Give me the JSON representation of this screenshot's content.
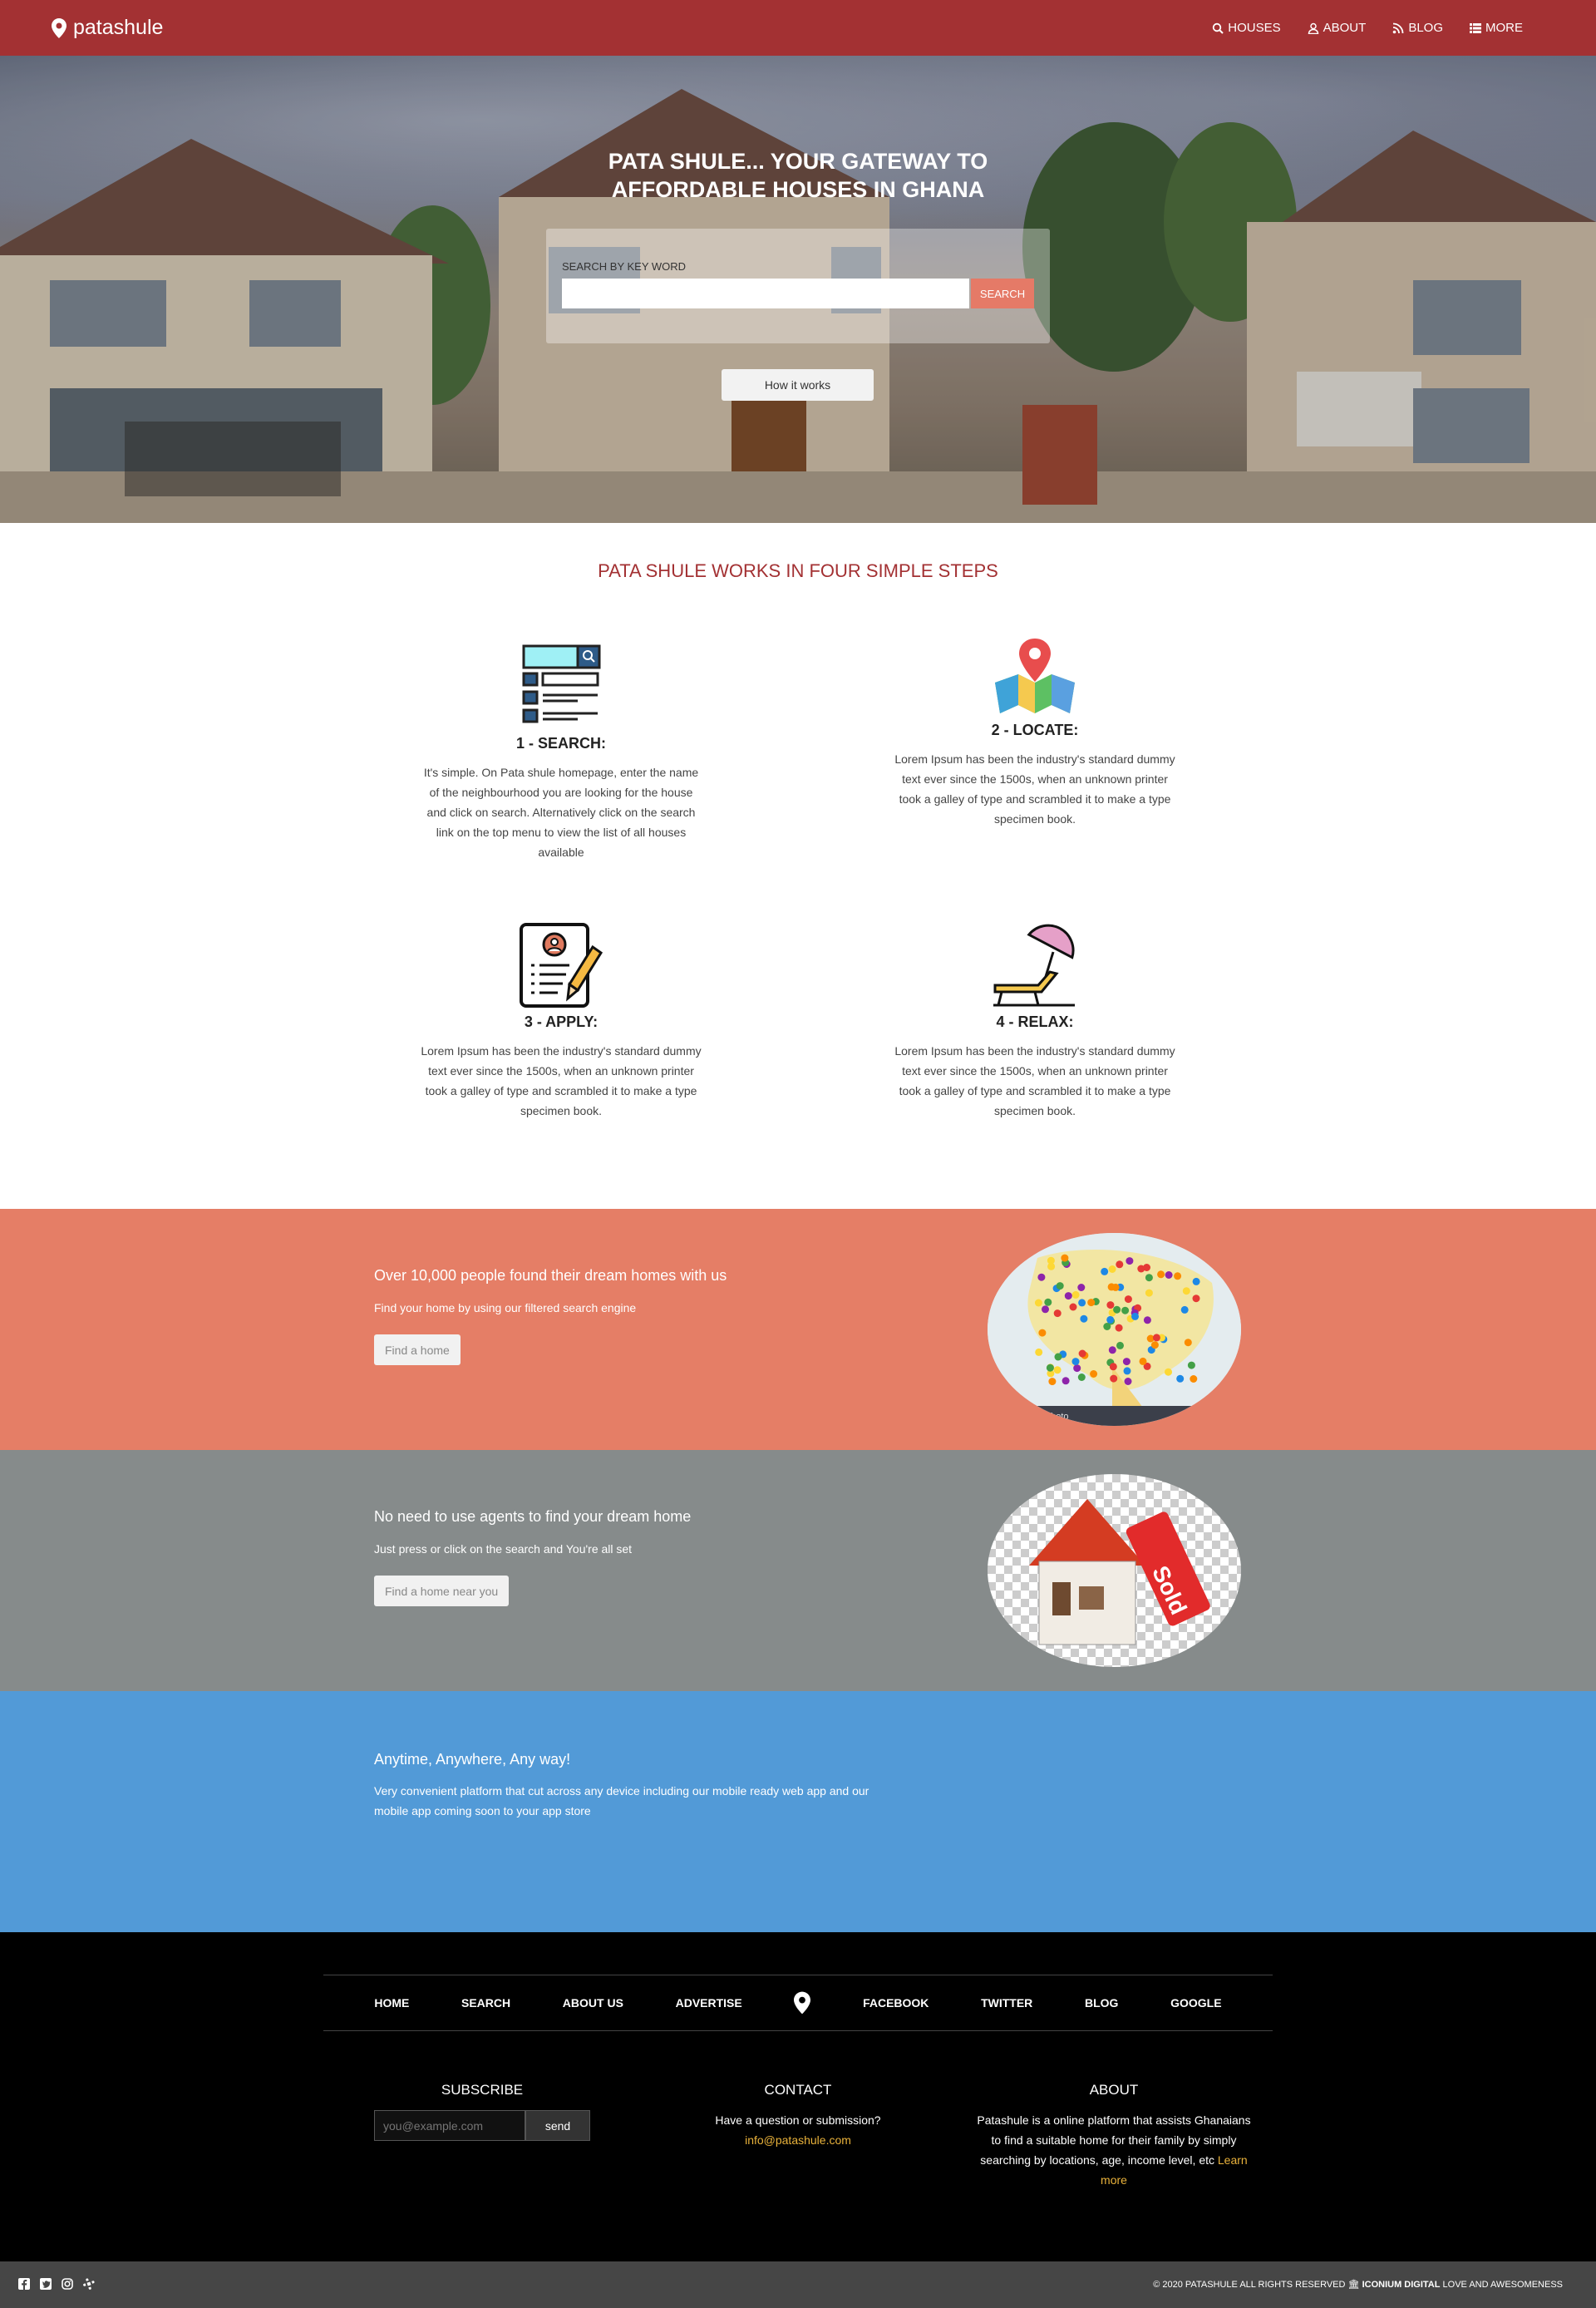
{
  "brand": {
    "name": "patashule"
  },
  "nav": {
    "items": [
      {
        "label": "HOUSES",
        "icon": "search-icon"
      },
      {
        "label": "ABOUT",
        "icon": "user-icon"
      },
      {
        "label": "BLOG",
        "icon": "rss-icon"
      },
      {
        "label": "MORE",
        "icon": "list-icon"
      }
    ]
  },
  "hero": {
    "title": "PATA SHULE... YOUR GATEWAY TO AFFORDABLE HOUSES IN GHANA",
    "search_label": "SEARCH BY KEY WORD",
    "search_value": "",
    "search_button": "SEARCH",
    "how_button": "How it works"
  },
  "steps": {
    "title": "PATA SHULE WORKS IN FOUR SIMPLE STEPS",
    "items": [
      {
        "title": "1 - SEARCH:",
        "text": "It's simple. On Pata shule homepage, enter the name of the neighbourhood you are looking for the house and click on search. Alternatively click on the search link on the top menu to view the list of all houses available"
      },
      {
        "title": "2 - LOCATE:",
        "text": "Lorem Ipsum has been the industry's standard dummy text ever since the 1500s, when an unknown printer took a galley of type and scrambled it to make a type specimen book."
      },
      {
        "title": "3 - APPLY:",
        "text": "Lorem Ipsum has been the industry's standard dummy text ever since the 1500s, when an unknown printer took a galley of type and scrambled it to make a type specimen book."
      },
      {
        "title": "4 - RELAX:",
        "text": "Lorem Ipsum has been the industry's standard dummy text ever since the 1500s, when an unknown printer took a galley of type and scrambled it to make a type specimen book."
      }
    ]
  },
  "band1": {
    "heading": "Over 10,000 people found their dream homes with us",
    "sub": "Find your home by using our filtered search engine",
    "button": "Find a home",
    "color": "#e57e66",
    "image_caption": "photo"
  },
  "band2": {
    "heading": "No need to use agents to find your dream home",
    "sub": "Just press or click on the search and You're all set",
    "button": "Find a home near you",
    "color": "#868b8b",
    "sign_text": "Sold"
  },
  "band3": {
    "heading": "Anytime, Anywhere, Any way!",
    "sub_line1": "Very convenient platform that cut across any device including our mobile ready web app and our",
    "sub_line2": "mobile app coming soon to your app store",
    "color": "#529ad7"
  },
  "footer": {
    "links": [
      "HOME",
      "SEARCH",
      "ABOUT US",
      "ADVERTISE",
      "FACEBOOK",
      "TWITTER",
      "BLOG",
      "GOOGLE"
    ],
    "subscribe": {
      "title": "SUBSCRIBE",
      "placeholder": "you@example.com",
      "button": "send"
    },
    "contact": {
      "title": "CONTACT",
      "text": "Have a question or submission?",
      "email": "info@patashule.com"
    },
    "about": {
      "title": "ABOUT",
      "line1": "Patashule is a online platform that assists Ghanaians",
      "line2": "to find a suitable home for their family by simply",
      "line3": "searching by locations, age, income level, etc",
      "link1": "Learn",
      "link2": "more"
    },
    "copyright_pre": "© 2020 PATASHULE ALL RIGHTS RESERVED",
    "copyright_brand": "ICONIUM DIGITAL",
    "copyright_post": "LOVE AND AWESOMENESS",
    "social_icons": [
      "facebook-icon",
      "twitter-icon",
      "instagram-icon",
      "slack-icon"
    ]
  }
}
